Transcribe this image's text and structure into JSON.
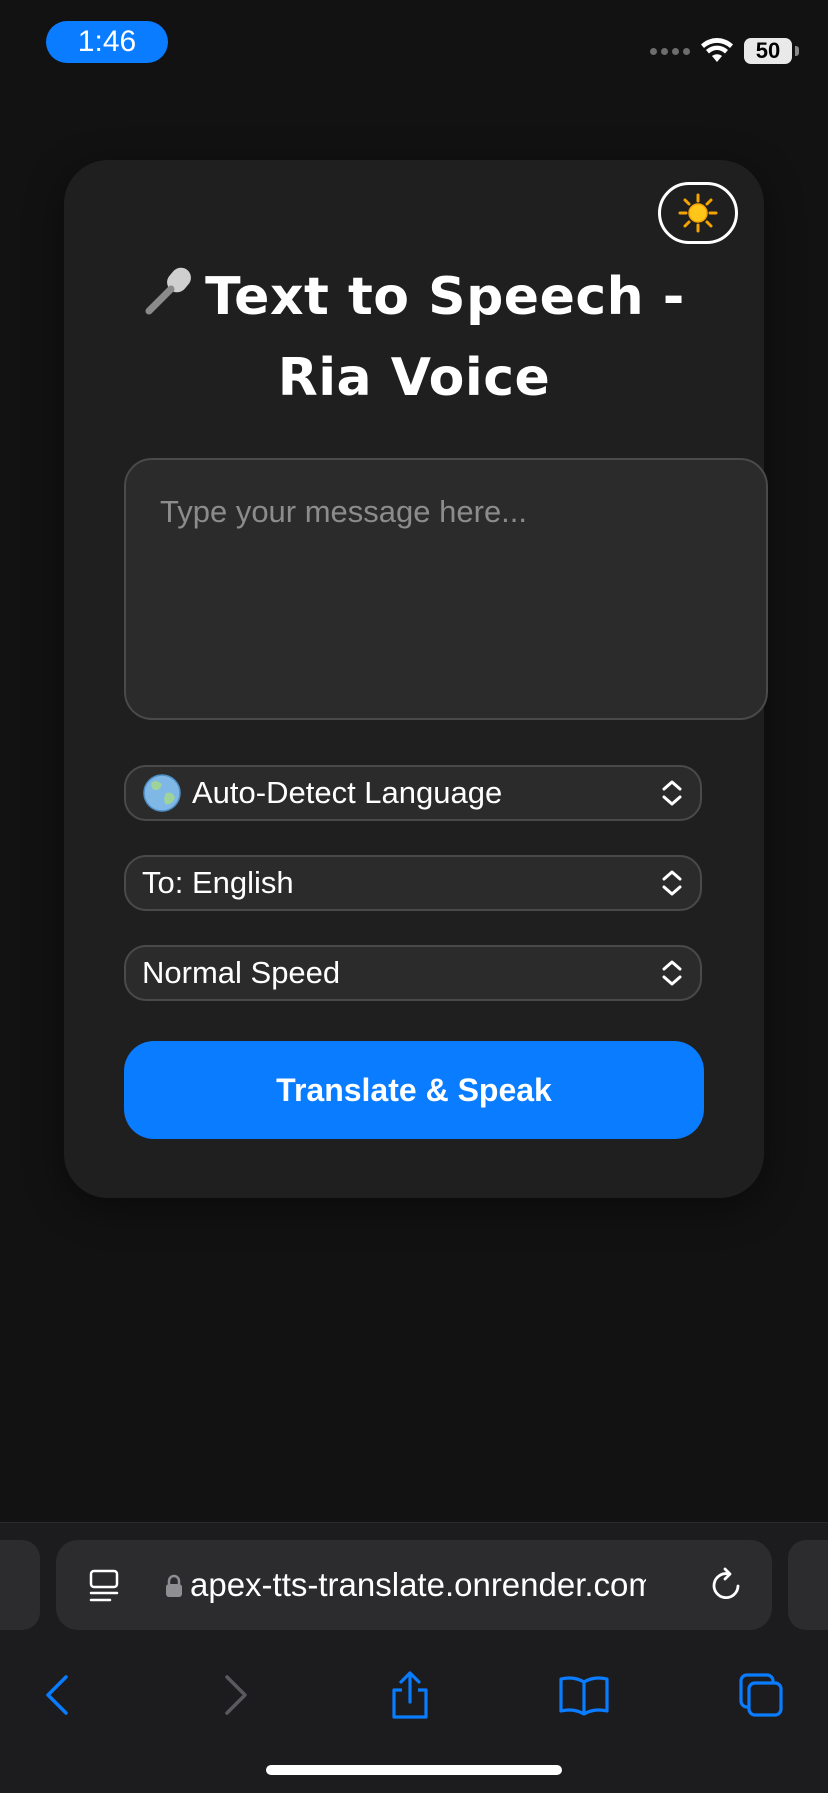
{
  "status_bar": {
    "time": "1:46",
    "battery": "50",
    "icons": [
      "signal-dots-icon",
      "wifi-icon",
      "battery-icon"
    ]
  },
  "app": {
    "theme_toggle_icon": "sun-icon",
    "title_icon": "microphone-icon",
    "title": "Text to Speech - Ria Voice",
    "message_placeholder": "Type your message here...",
    "message_value": "",
    "source_language": {
      "icon": "globe-icon",
      "label": "Auto-Detect Language"
    },
    "target_language": {
      "label": "To: English"
    },
    "speed": {
      "label": "Normal Speed"
    },
    "action_button": "Translate & Speak",
    "colors": {
      "accent": "#0a7cff",
      "card": "#1f1f1f",
      "background": "#121212"
    }
  },
  "browser": {
    "url": "apex-tts-translate.onrender.com",
    "toolbar_icons": [
      "back-icon",
      "forward-icon",
      "share-icon",
      "bookmarks-icon",
      "tabs-icon"
    ]
  }
}
